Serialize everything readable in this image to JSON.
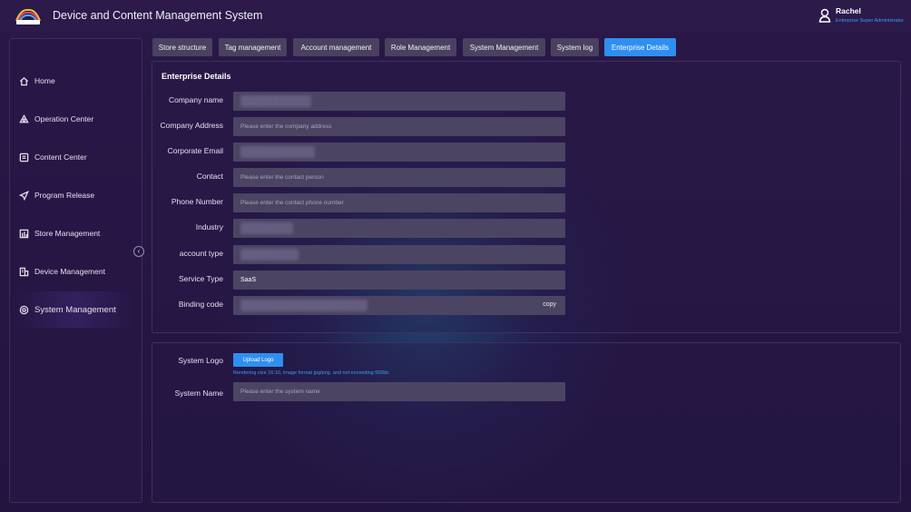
{
  "app": {
    "title": "Device and Content Management System",
    "user_name": "Rachel",
    "user_role": "Enterprise Super Administrator"
  },
  "sidebar": {
    "items": [
      {
        "label": "Home",
        "icon": "home-icon"
      },
      {
        "label": "Operation Center",
        "icon": "operation-icon"
      },
      {
        "label": "Content Center",
        "icon": "content-icon"
      },
      {
        "label": "Program Release",
        "icon": "send-icon"
      },
      {
        "label": "Store Management",
        "icon": "store-icon"
      },
      {
        "label": "Device Management",
        "icon": "device-icon"
      },
      {
        "label": "System Management",
        "icon": "gear-icon",
        "active": true
      }
    ],
    "collapse_glyph": "‹"
  },
  "tabs": [
    {
      "label": "Store structure"
    },
    {
      "label": "Tag management"
    },
    {
      "label": "Account management"
    },
    {
      "label": "Role Management"
    },
    {
      "label": "System Management"
    },
    {
      "label": "System log"
    },
    {
      "label": "Enterprise Details",
      "active": true
    }
  ],
  "enterprise": {
    "title": "Enterprise Details",
    "fields": [
      {
        "label": "Company name",
        "value": "",
        "placeholder": ""
      },
      {
        "label": "Company Address",
        "value": "",
        "placeholder": "Please enter the company address"
      },
      {
        "label": "Corporate Email",
        "value": "",
        "placeholder": ""
      },
      {
        "label": "Contact",
        "value": "",
        "placeholder": "Please enter the contact person"
      },
      {
        "label": "Phone Number",
        "value": "",
        "placeholder": "Please enter the contact phone number"
      },
      {
        "label": "Industry",
        "value": "",
        "placeholder": ""
      },
      {
        "label": "account type",
        "value": "",
        "placeholder": ""
      },
      {
        "label": "Service Type",
        "value": "SaaS",
        "placeholder": ""
      },
      {
        "label": "Binding code",
        "value": "",
        "placeholder": ""
      }
    ],
    "copy_label": "copy"
  },
  "logo_section": {
    "logo_label": "System Logo",
    "upload_label": "Upload Logo",
    "hint": "Rendering size 16:10, image format jpg/png, and not exceeding 500kb.",
    "name_label": "System Name",
    "name_placeholder": "Please enter the system name"
  },
  "colors": {
    "accent": "#2f8ff0",
    "background": "#231540",
    "field": "#4b4463"
  }
}
